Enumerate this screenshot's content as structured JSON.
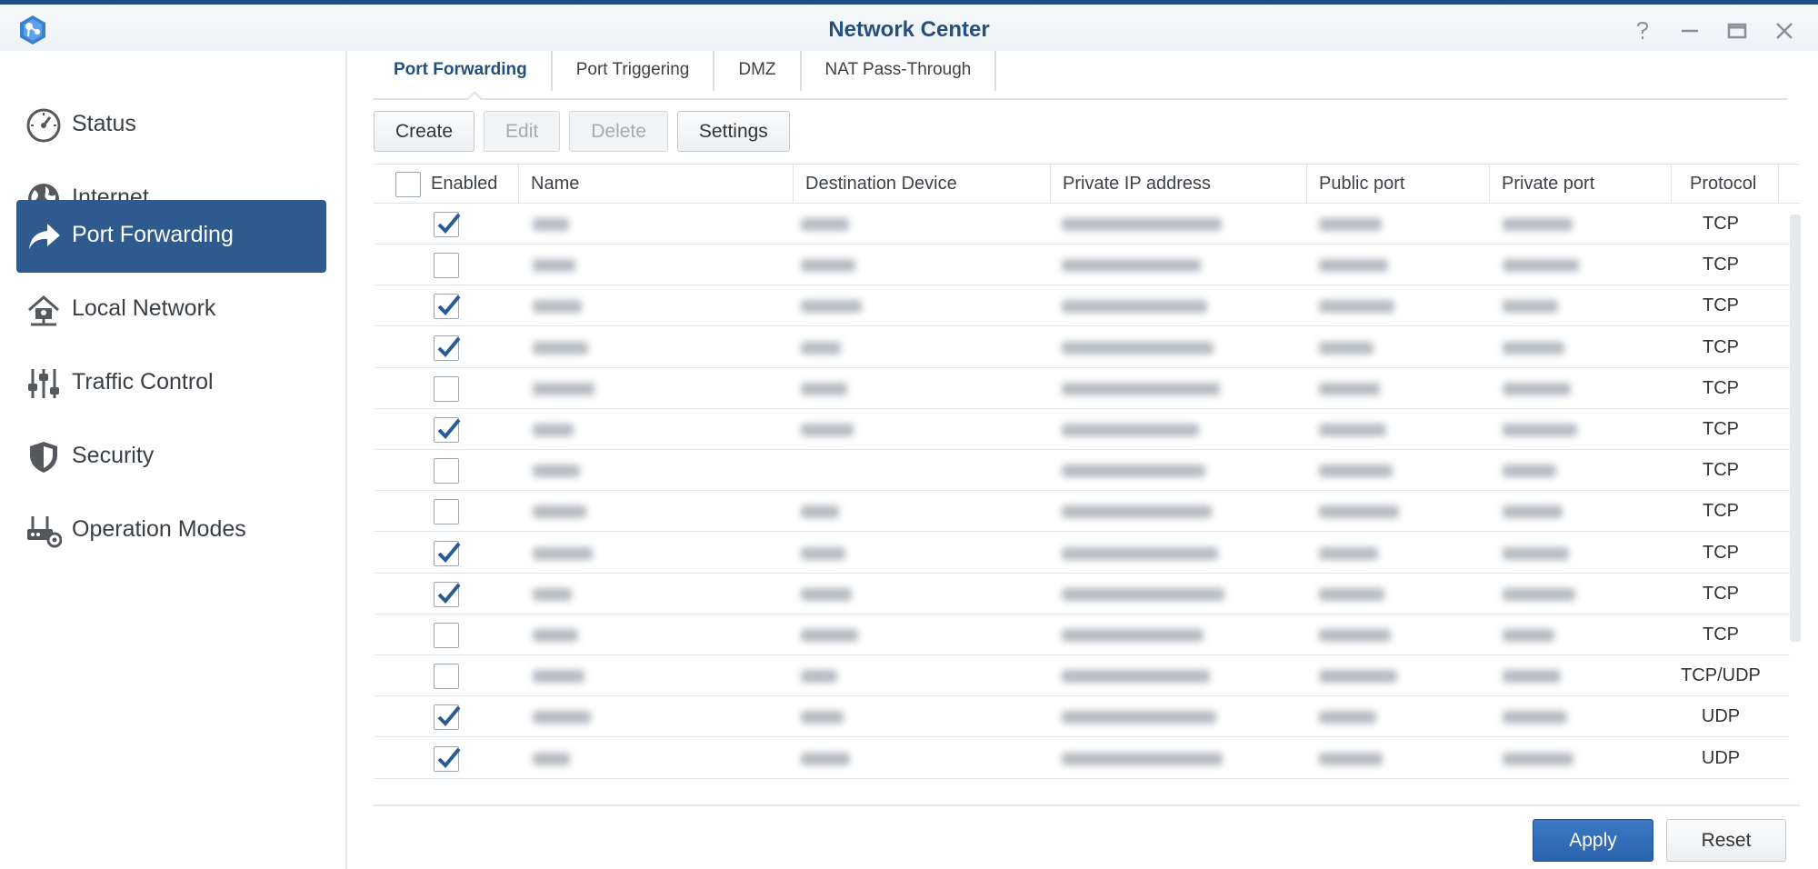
{
  "window": {
    "title": "Network Center",
    "controls": [
      "help",
      "minimize",
      "maximize",
      "close"
    ]
  },
  "sidebar": {
    "items": [
      {
        "label": "Status",
        "icon": "speedometer-icon",
        "active": false
      },
      {
        "label": "Internet",
        "icon": "globe-icon",
        "active": false
      },
      {
        "label": "Port Forwarding",
        "icon": "forward-arrow-icon",
        "active": true
      },
      {
        "label": "Local Network",
        "icon": "home-network-icon",
        "active": false
      },
      {
        "label": "Traffic Control",
        "icon": "sliders-icon",
        "active": false
      },
      {
        "label": "Security",
        "icon": "shield-icon",
        "active": false
      },
      {
        "label": "Operation Modes",
        "icon": "router-gear-icon",
        "active": false
      }
    ]
  },
  "tabs": [
    {
      "label": "Port Forwarding",
      "active": true
    },
    {
      "label": "Port Triggering",
      "active": false
    },
    {
      "label": "DMZ",
      "active": false
    },
    {
      "label": "NAT Pass-Through",
      "active": false
    }
  ],
  "toolbar": {
    "create_label": "Create",
    "edit_label": "Edit",
    "delete_label": "Delete",
    "settings_label": "Settings"
  },
  "table": {
    "columns": [
      "Enabled",
      "Name",
      "Destination Device",
      "Private IP address",
      "Public port",
      "Private port",
      "Protocol"
    ],
    "rows": [
      {
        "enabled": true,
        "protocol": "TCP"
      },
      {
        "enabled": false,
        "protocol": "TCP"
      },
      {
        "enabled": true,
        "protocol": "TCP"
      },
      {
        "enabled": true,
        "protocol": "TCP"
      },
      {
        "enabled": false,
        "protocol": "TCP"
      },
      {
        "enabled": true,
        "protocol": "TCP"
      },
      {
        "enabled": false,
        "protocol": "TCP"
      },
      {
        "enabled": false,
        "protocol": "TCP"
      },
      {
        "enabled": true,
        "protocol": "TCP"
      },
      {
        "enabled": true,
        "protocol": "TCP"
      },
      {
        "enabled": false,
        "protocol": "TCP"
      },
      {
        "enabled": false,
        "protocol": "TCP/UDP"
      },
      {
        "enabled": true,
        "protocol": "UDP"
      },
      {
        "enabled": true,
        "protocol": "UDP"
      }
    ]
  },
  "footer": {
    "apply_label": "Apply",
    "reset_label": "Reset"
  },
  "colors": {
    "accent": "#2e5a8e",
    "title": "#24507d",
    "apply": "#2f6bb5"
  }
}
